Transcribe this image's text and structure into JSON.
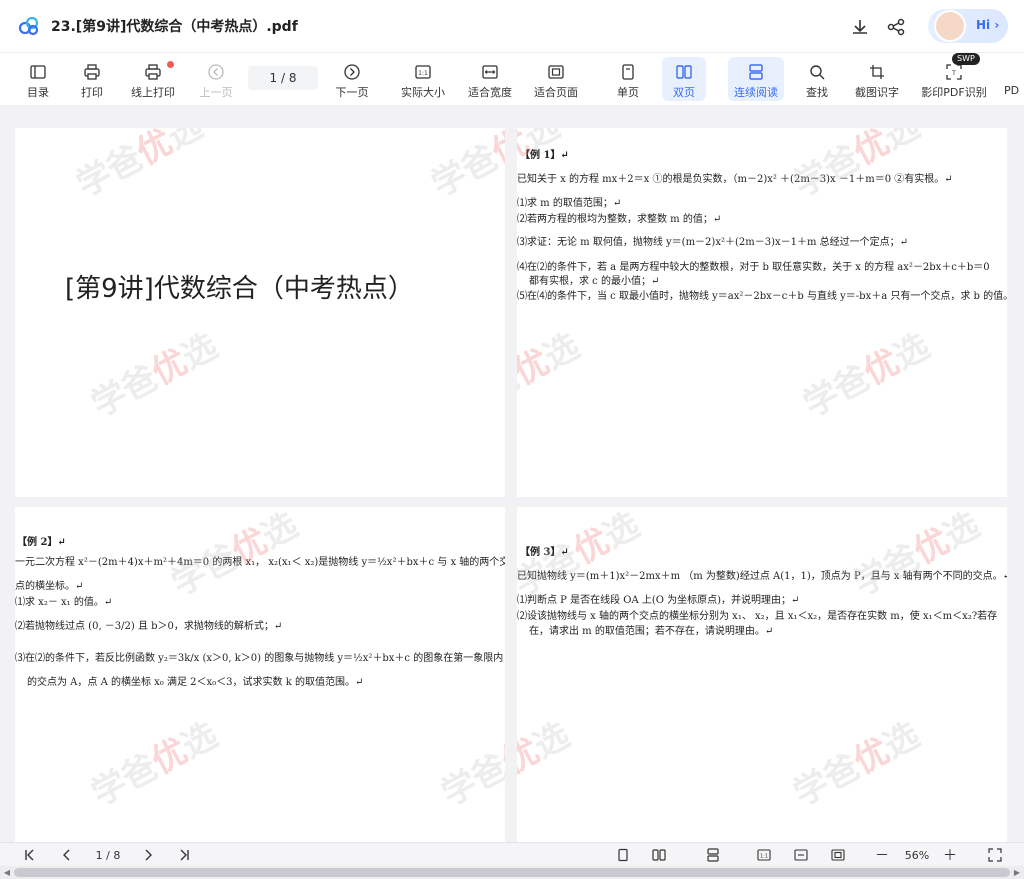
{
  "app": {
    "title": "23.[第9讲]代数综合（中考热点）.pdf",
    "hi_label": "Hi ›"
  },
  "toolbar": {
    "items": [
      {
        "id": "toc",
        "label": "目录"
      },
      {
        "id": "print",
        "label": "打印"
      },
      {
        "id": "online_print",
        "label": "线上打印"
      },
      {
        "id": "prev",
        "label": "上一页"
      },
      {
        "id": "next",
        "label": "下一页"
      },
      {
        "id": "actual",
        "label": "实际大小"
      },
      {
        "id": "fit_width",
        "label": "适合宽度"
      },
      {
        "id": "fit_page",
        "label": "适合页面"
      },
      {
        "id": "single",
        "label": "单页"
      },
      {
        "id": "double",
        "label": "双页"
      },
      {
        "id": "continuous",
        "label": "连续阅读"
      },
      {
        "id": "find",
        "label": "查找"
      },
      {
        "id": "ocr",
        "label": "截图识字"
      },
      {
        "id": "pdf_ocr",
        "label": "影印PDF识别"
      },
      {
        "id": "more",
        "label": "PD"
      }
    ],
    "page_indicator": "1 / 8",
    "swp_badge": "SWP"
  },
  "pages": {
    "cover_title": "[第9讲]代数综合（中考热点）",
    "ex1": {
      "heading": "【例 1】↵",
      "lines": [
        "已知关于 x 的方程 mx＋2＝x ①的根是负实数，（m－2)x² ＋(2m－3)x －1＋m＝0 ②有实根。↵",
        "⑴求 m 的取值范围；↵",
        "⑵若两方程的根均为整数，求整数 m 的值；↵",
        "⑶求证：无论 m 取何值，抛物线 y＝(m－2)x²＋(2m－3)x－1＋m 总经过一个定点；↵",
        "⑷在⑵的条件下，若 a 是两方程中较大的整数根，对于 b 取任意实数，关于 x 的方程 ax²－2bx＋c＋b＝0",
        "都有实根，求 c 的最小值；↵",
        "⑸在⑷的条件下，当 c 取最小值时，抛物线 y＝ax²－2bx－c＋b 与直线 y＝-bx＋a 只有一个交点，求 b 的值。"
      ]
    },
    "ex2": {
      "heading": "【例 2】↵",
      "lines": [
        "一元二次方程 x²－(2m＋4)x＋m²＋4m＝0 的两根 x₁， x₂(x₁＜ x₂)是抛物线 y＝½x²＋bx＋c 与 x 轴的两个交",
        "点的横坐标。↵",
        "⑴求 x₂－ x₁ 的值。↵",
        "⑵若抛物线过点 (0, －3/2) 且 b＞0，求抛物线的解析式；↵",
        "⑶在⑵的条件下，若反比例函数 y₂＝3k/x (x＞0, k＞0) 的图象与抛物线 y＝½x²＋bx＋c 的图象在第一象限内",
        "的交点为 A，点 A 的横坐标 x₀ 满足 2＜x₀＜3，试求实数 k 的取值范围。↵"
      ]
    },
    "ex3": {
      "heading": "【例 3】↵",
      "lines": [
        "已知抛物线 y＝(m＋1)x²－2mx＋m （m 为整数)经过点 A(1，1)，顶点为 P，且与 x 轴有两个不同的交点。↵",
        "⑴判断点 P 是否在线段 OA 上(O 为坐标原点)，并说明理由；↵",
        "⑵设该抛物线与 x 轴的两个交点的横坐标分别为 x₁、 x₂，且 x₁＜x₂，是否存在实数 m，使 x₁＜m＜x₂?若存",
        "在，请求出 m 的取值范围；若不存在，请说明理由。↵"
      ]
    },
    "watermark_left": "学爸",
    "watermark_mid": "优",
    "watermark_right": "选"
  },
  "statusbar": {
    "page_indicator": "1 / 8",
    "zoom": "56%",
    "minus": "－",
    "plus": "＋"
  }
}
